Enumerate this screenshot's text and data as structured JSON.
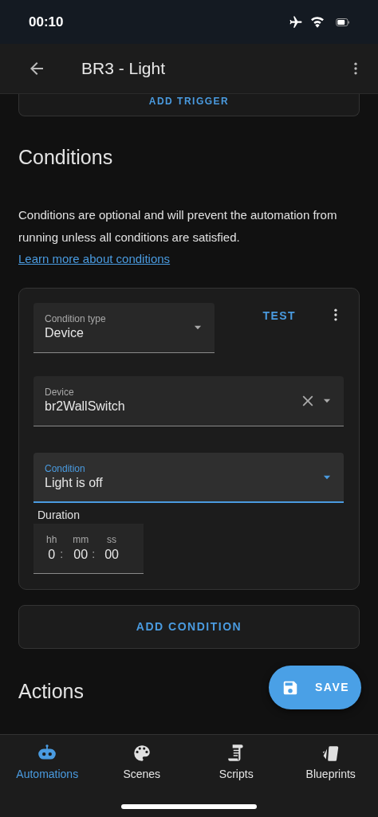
{
  "status_bar": {
    "time": "00:10"
  },
  "app_bar": {
    "title": "BR3 - Light"
  },
  "trigger_button": {
    "label": "ADD TRIGGER"
  },
  "conditions": {
    "heading": "Conditions",
    "description": "Conditions are optional and will prevent the automation from running unless all conditions are satisfied.",
    "link": "Learn more about conditions"
  },
  "condition_card": {
    "test_button": "TEST",
    "fields": [
      {
        "label": "Condition type",
        "value": "Device",
        "clearable": false,
        "focused": false
      },
      {
        "label": "Device",
        "value": "br2WallSwitch",
        "clearable": true,
        "focused": false
      },
      {
        "label": "Condition",
        "value": "Light is off",
        "clearable": false,
        "focused": true
      }
    ],
    "duration": {
      "label": "Duration",
      "separator": ":",
      "units": [
        {
          "label": "hh",
          "value": "0"
        },
        {
          "label": "mm",
          "value": "00"
        },
        {
          "label": "ss",
          "value": "00"
        }
      ]
    }
  },
  "add_condition_button": "ADD CONDITION",
  "actions_heading": "Actions",
  "save_button": "SAVE",
  "nav": [
    {
      "label": "Automations",
      "selected": true
    },
    {
      "label": "Scenes",
      "selected": false
    },
    {
      "label": "Scripts",
      "selected": false
    },
    {
      "label": "Blueprints",
      "selected": false
    }
  ]
}
